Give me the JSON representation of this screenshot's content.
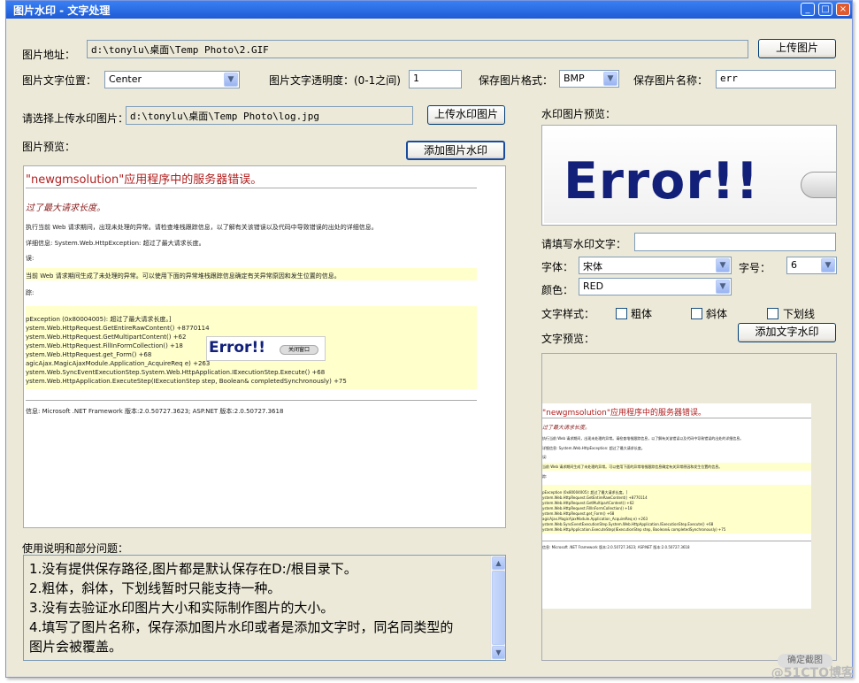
{
  "window": {
    "title": "图片水印 - 文字处理"
  },
  "form": {
    "image_path_label": "图片地址：",
    "image_path_value": "d:\\tonylu\\桌面\\Temp Photo\\2.GIF",
    "upload_image_btn": "上传图片",
    "text_position_label": "图片文字位置：",
    "text_position_value": "Center",
    "opacity_label": "图片文字透明度：(0-1之间)",
    "opacity_value": "1",
    "save_format_label": "保存图片格式：",
    "save_format_value": "BMP",
    "save_name_label": "保存图片名称：",
    "save_name_value": "err",
    "watermark_image_label": "请选择上传水印图片：",
    "watermark_image_value": "d:\\tonylu\\桌面\\Temp Photo\\log.jpg",
    "upload_watermark_btn": "上传水印图片",
    "image_preview_label": "图片预览：",
    "add_image_watermark_btn": "添加图片水印",
    "watermark_preview_label": "水印图片预览：",
    "watermark_text_label": "请填写水印文字：",
    "watermark_text_value": "",
    "font_label": "字体：",
    "font_value": "宋体",
    "font_size_label": "字号：",
    "font_size_value": "6",
    "color_label": "颜色：",
    "color_value": "RED",
    "text_style_label": "文字样式：",
    "bold_label": "粗体",
    "italic_label": "斜体",
    "underline_label": "下划线",
    "text_preview_label": "文字预览：",
    "add_text_watermark_btn": "添加文字水印",
    "instructions_label": "使用说明和部分问题："
  },
  "instructions": [
    "1.没有提供保存路径,图片都是默认保存在D:/根目录下。",
    "2.粗体，斜体，下划线暂时只能支持一种。",
    "3.没有去验证水印图片大小和实际制作图片的大小。",
    "4.填写了图片名称，保存添加图片水印或者是添加文字时，同名同类型的",
    "图片会被覆盖。"
  ],
  "preview": {
    "heading": "\"newgmsolution\"应用程序中的服务器错误。",
    "subheading": "过了最大请求长度。",
    "line1": "执行当前 Web 请求期间，出现未处理的异常。请检查堆栈跟踪信息，以了解有关该错误以及代码中导致错误的出处的详细信息。",
    "line2": "详细信息: System.Web.HttpException: 超过了最大请求长度。",
    "line3": "误:",
    "line4": "当前 Web 请求期间生成了未处理的异常。可以使用下面的异常堆栈跟踪信息确定有关异常原因和发生位置的信息。",
    "line5": "踪:",
    "stack": [
      "pException (0x80004005): 超过了最大请求长度。]",
      "ystem.Web.HttpRequest.GetEntireRawContent() +8770114",
      "ystem.Web.HttpRequest.GetMultipartContent() +62",
      "ystem.Web.HttpRequest.FillInFormCollection() +18",
      "ystem.Web.HttpRequest.get_Form() +68",
      "agicAjax.MagicAjaxModule.Application_AcquireReq                       e) +263",
      "ystem.Web.SyncEventExecutionStep.System.Web.HttpApplication.IExecutionStep.Execute() +68",
      "ystem.Web.HttpApplication.ExecuteStep(IExecutionStep step, Boolean& completedSynchronously) +75"
    ],
    "version": "信息: Microsoft .NET Framework 版本:2.0.50727.3623; ASP.NET 版本:2.0.50727.3618",
    "logo_text": "Error!!",
    "logo_btn": "关闭窗口"
  },
  "watermark_logo_text": "Error!!",
  "corner_button": "确定截图",
  "corner_mark": "@51CTO博客"
}
